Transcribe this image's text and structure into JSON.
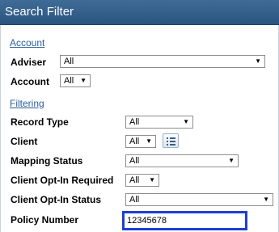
{
  "header": {
    "title": "Search Filter"
  },
  "sections": {
    "account": "Account",
    "filtering": "Filtering"
  },
  "fields": {
    "adviser": {
      "label": "Adviser",
      "value": "All"
    },
    "account": {
      "label": "Account",
      "value": "All"
    },
    "record_type": {
      "label": "Record Type",
      "value": "All"
    },
    "client": {
      "label": "Client",
      "value": "All",
      "list_icon": "list-icon"
    },
    "mapping_status": {
      "label": "Mapping Status",
      "value": "All"
    },
    "client_optin_required": {
      "label": "Client Opt-In Required",
      "value": "All"
    },
    "client_optin_status": {
      "label": "Client Opt-In Status",
      "value": "All"
    },
    "policy_number": {
      "label": "Policy Number",
      "value": "12345678"
    }
  },
  "colors": {
    "header": "#2b5580",
    "section_link": "#2c5f9b",
    "focus_border": "#1d3fcf"
  }
}
